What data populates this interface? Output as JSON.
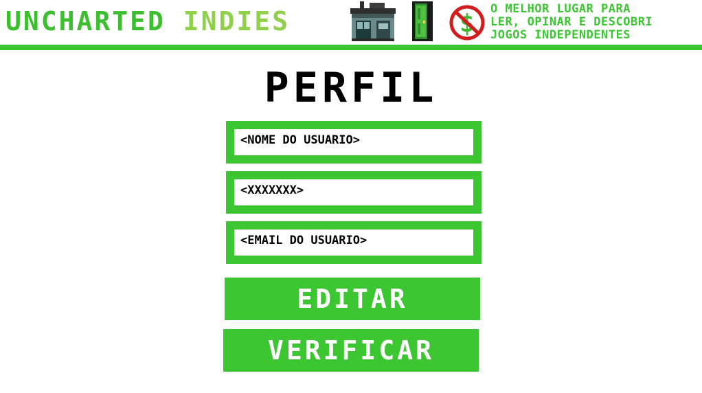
{
  "header": {
    "brand_part1": "UNCHARTED",
    "brand_part2": "INDIES",
    "tagline_line1": "O MELHOR LUGAR PARA",
    "tagline_line2": "LER, OPINAR E DESCOBRI",
    "tagline_line3": "JOGOS INDEPENDENTES",
    "icons": [
      "home-icon",
      "door-icon",
      "no-money-icon"
    ],
    "accent_color": "#3cc632",
    "brand_secondary_color": "#8fd14a"
  },
  "main": {
    "title": "PERFIL",
    "fields": {
      "username_placeholder": "<NOME DO USUARIO>",
      "password_placeholder": "<XXXXXXX>",
      "email_placeholder": "<EMAIL DO USUARIO>"
    },
    "buttons": {
      "edit_label": "EDITAR",
      "verify_label": "VERIFICAR"
    }
  }
}
